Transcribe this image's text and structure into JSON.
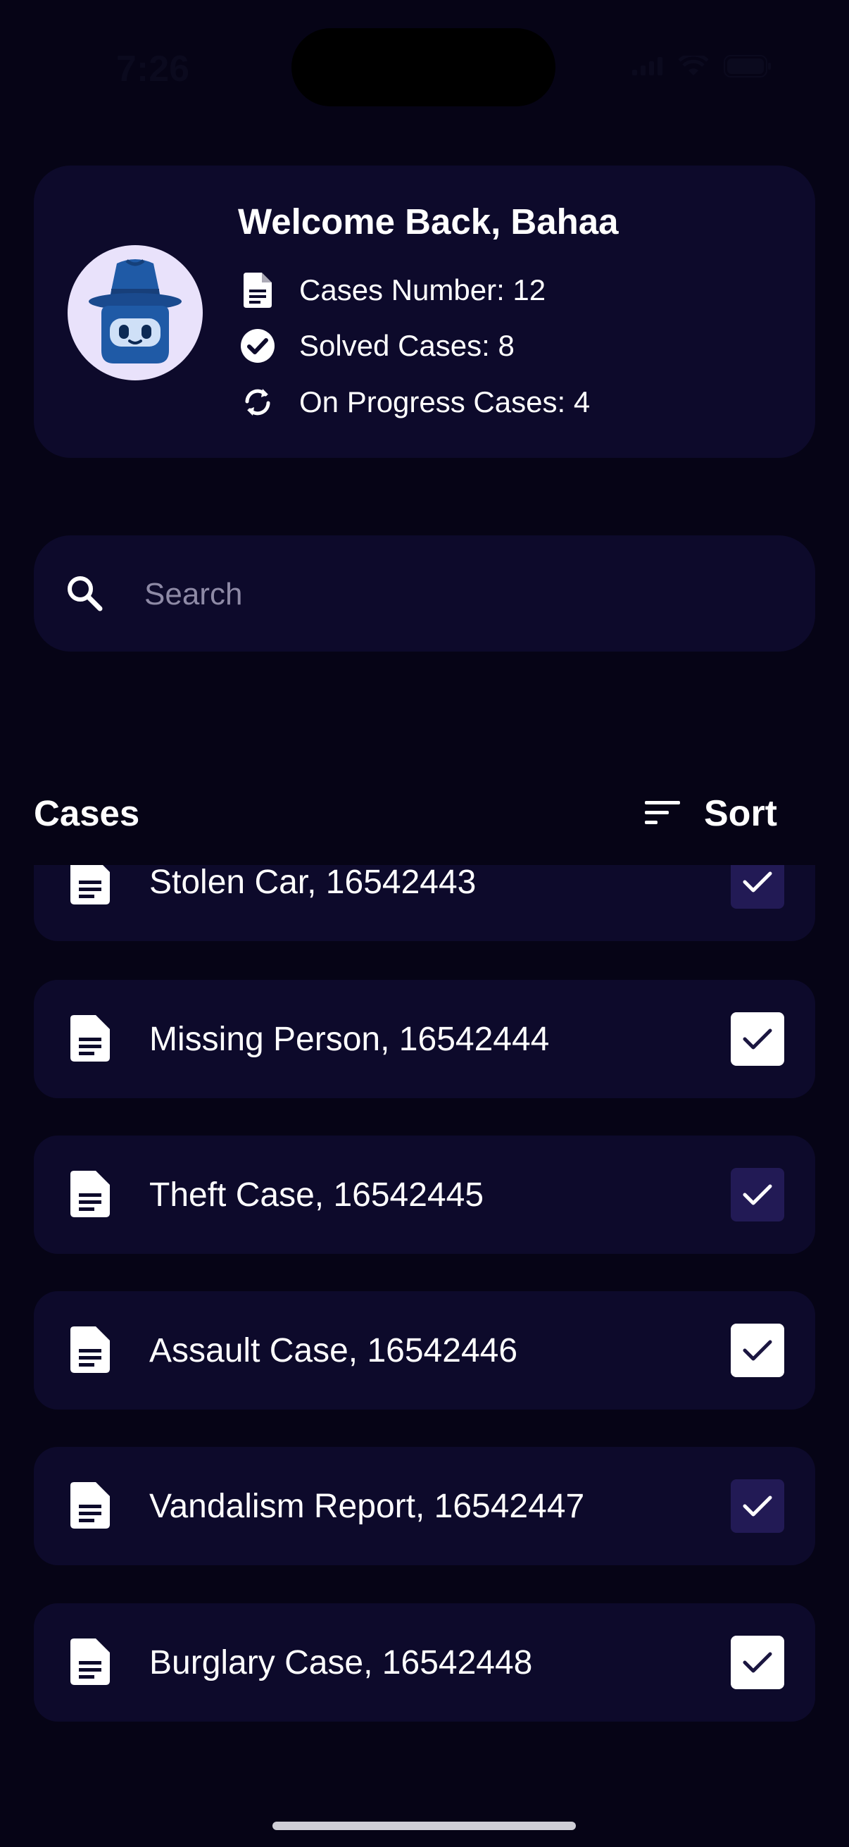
{
  "status_bar": {
    "time": "7:26"
  },
  "profile": {
    "welcome": "Welcome Back, Bahaa",
    "stats": [
      {
        "icon": "document-icon",
        "text": "Cases Number: 12"
      },
      {
        "icon": "check-circle-icon",
        "text": "Solved Cases: 8"
      },
      {
        "icon": "refresh-icon",
        "text": "On Progress Cases: 4"
      }
    ]
  },
  "search": {
    "placeholder": "Search",
    "value": ""
  },
  "cases_section": {
    "title": "Cases",
    "sort_label": "Sort"
  },
  "cases": [
    {
      "label": "Stolen Car, 16542443",
      "checked": true,
      "style": "dark"
    },
    {
      "label": "Missing Person, 16542444",
      "checked": true,
      "style": "light"
    },
    {
      "label": "Theft Case, 16542445",
      "checked": true,
      "style": "dark"
    },
    {
      "label": "Assault Case, 16542446",
      "checked": true,
      "style": "light"
    },
    {
      "label": "Vandalism Report, 16542447",
      "checked": true,
      "style": "dark"
    },
    {
      "label": "Burglary Case, 16542448",
      "checked": true,
      "style": "light"
    }
  ],
  "colors": {
    "background": "#060416",
    "card": "#0d0a2b",
    "checkbox_dark": "#221a55",
    "avatar_bg": "#e9e2fb",
    "avatar_blue": "#1f5aa6"
  }
}
